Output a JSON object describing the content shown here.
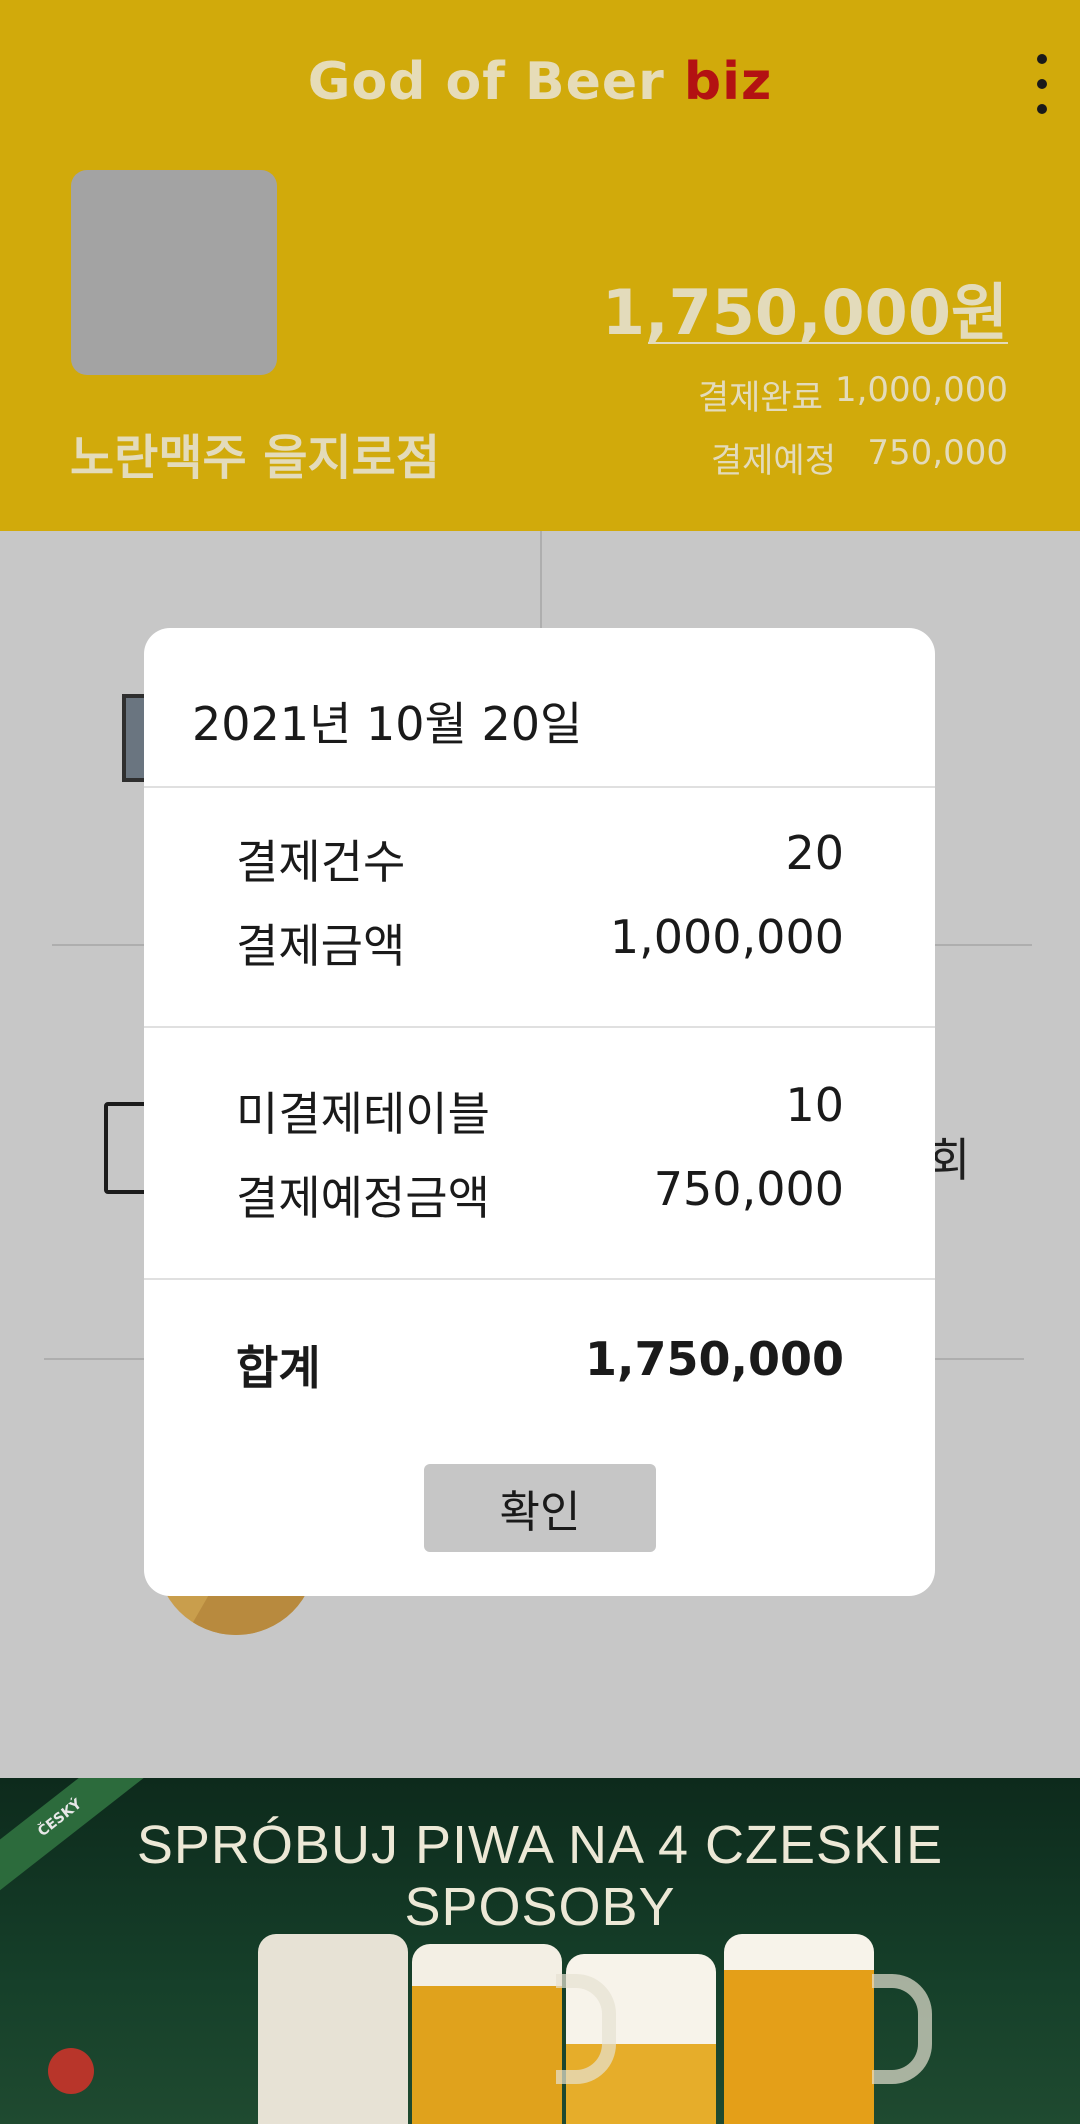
{
  "header": {
    "title_main": "God of Beer ",
    "title_accent": "biz",
    "store_name": "노란맥주 을지로점",
    "total_amount": "1,750,000원",
    "completed_label": "결제완료",
    "completed_value": "1,000,000",
    "scheduled_label": "결제예정",
    "scheduled_value": "750,000"
  },
  "background": {
    "partial_text": "회"
  },
  "dialog": {
    "date": "2021년 10월 20일",
    "rows": [
      {
        "label": "결제건수",
        "value": "20"
      },
      {
        "label": "결제금액",
        "value": "1,000,000"
      },
      {
        "label": "미결제테이블",
        "value": "10"
      },
      {
        "label": "결제예정금액",
        "value": "750,000"
      }
    ],
    "total_label": "합계",
    "total_value": "1,750,000",
    "confirm_label": "확인"
  },
  "ad": {
    "headline": "SPRÓBUJ PIWA NA 4 CZESKIE SPOSOBY",
    "corner_badge": "ČESKÝ"
  },
  "colors": {
    "header_bg": "#d1aa0b",
    "accent": "#b31212"
  }
}
